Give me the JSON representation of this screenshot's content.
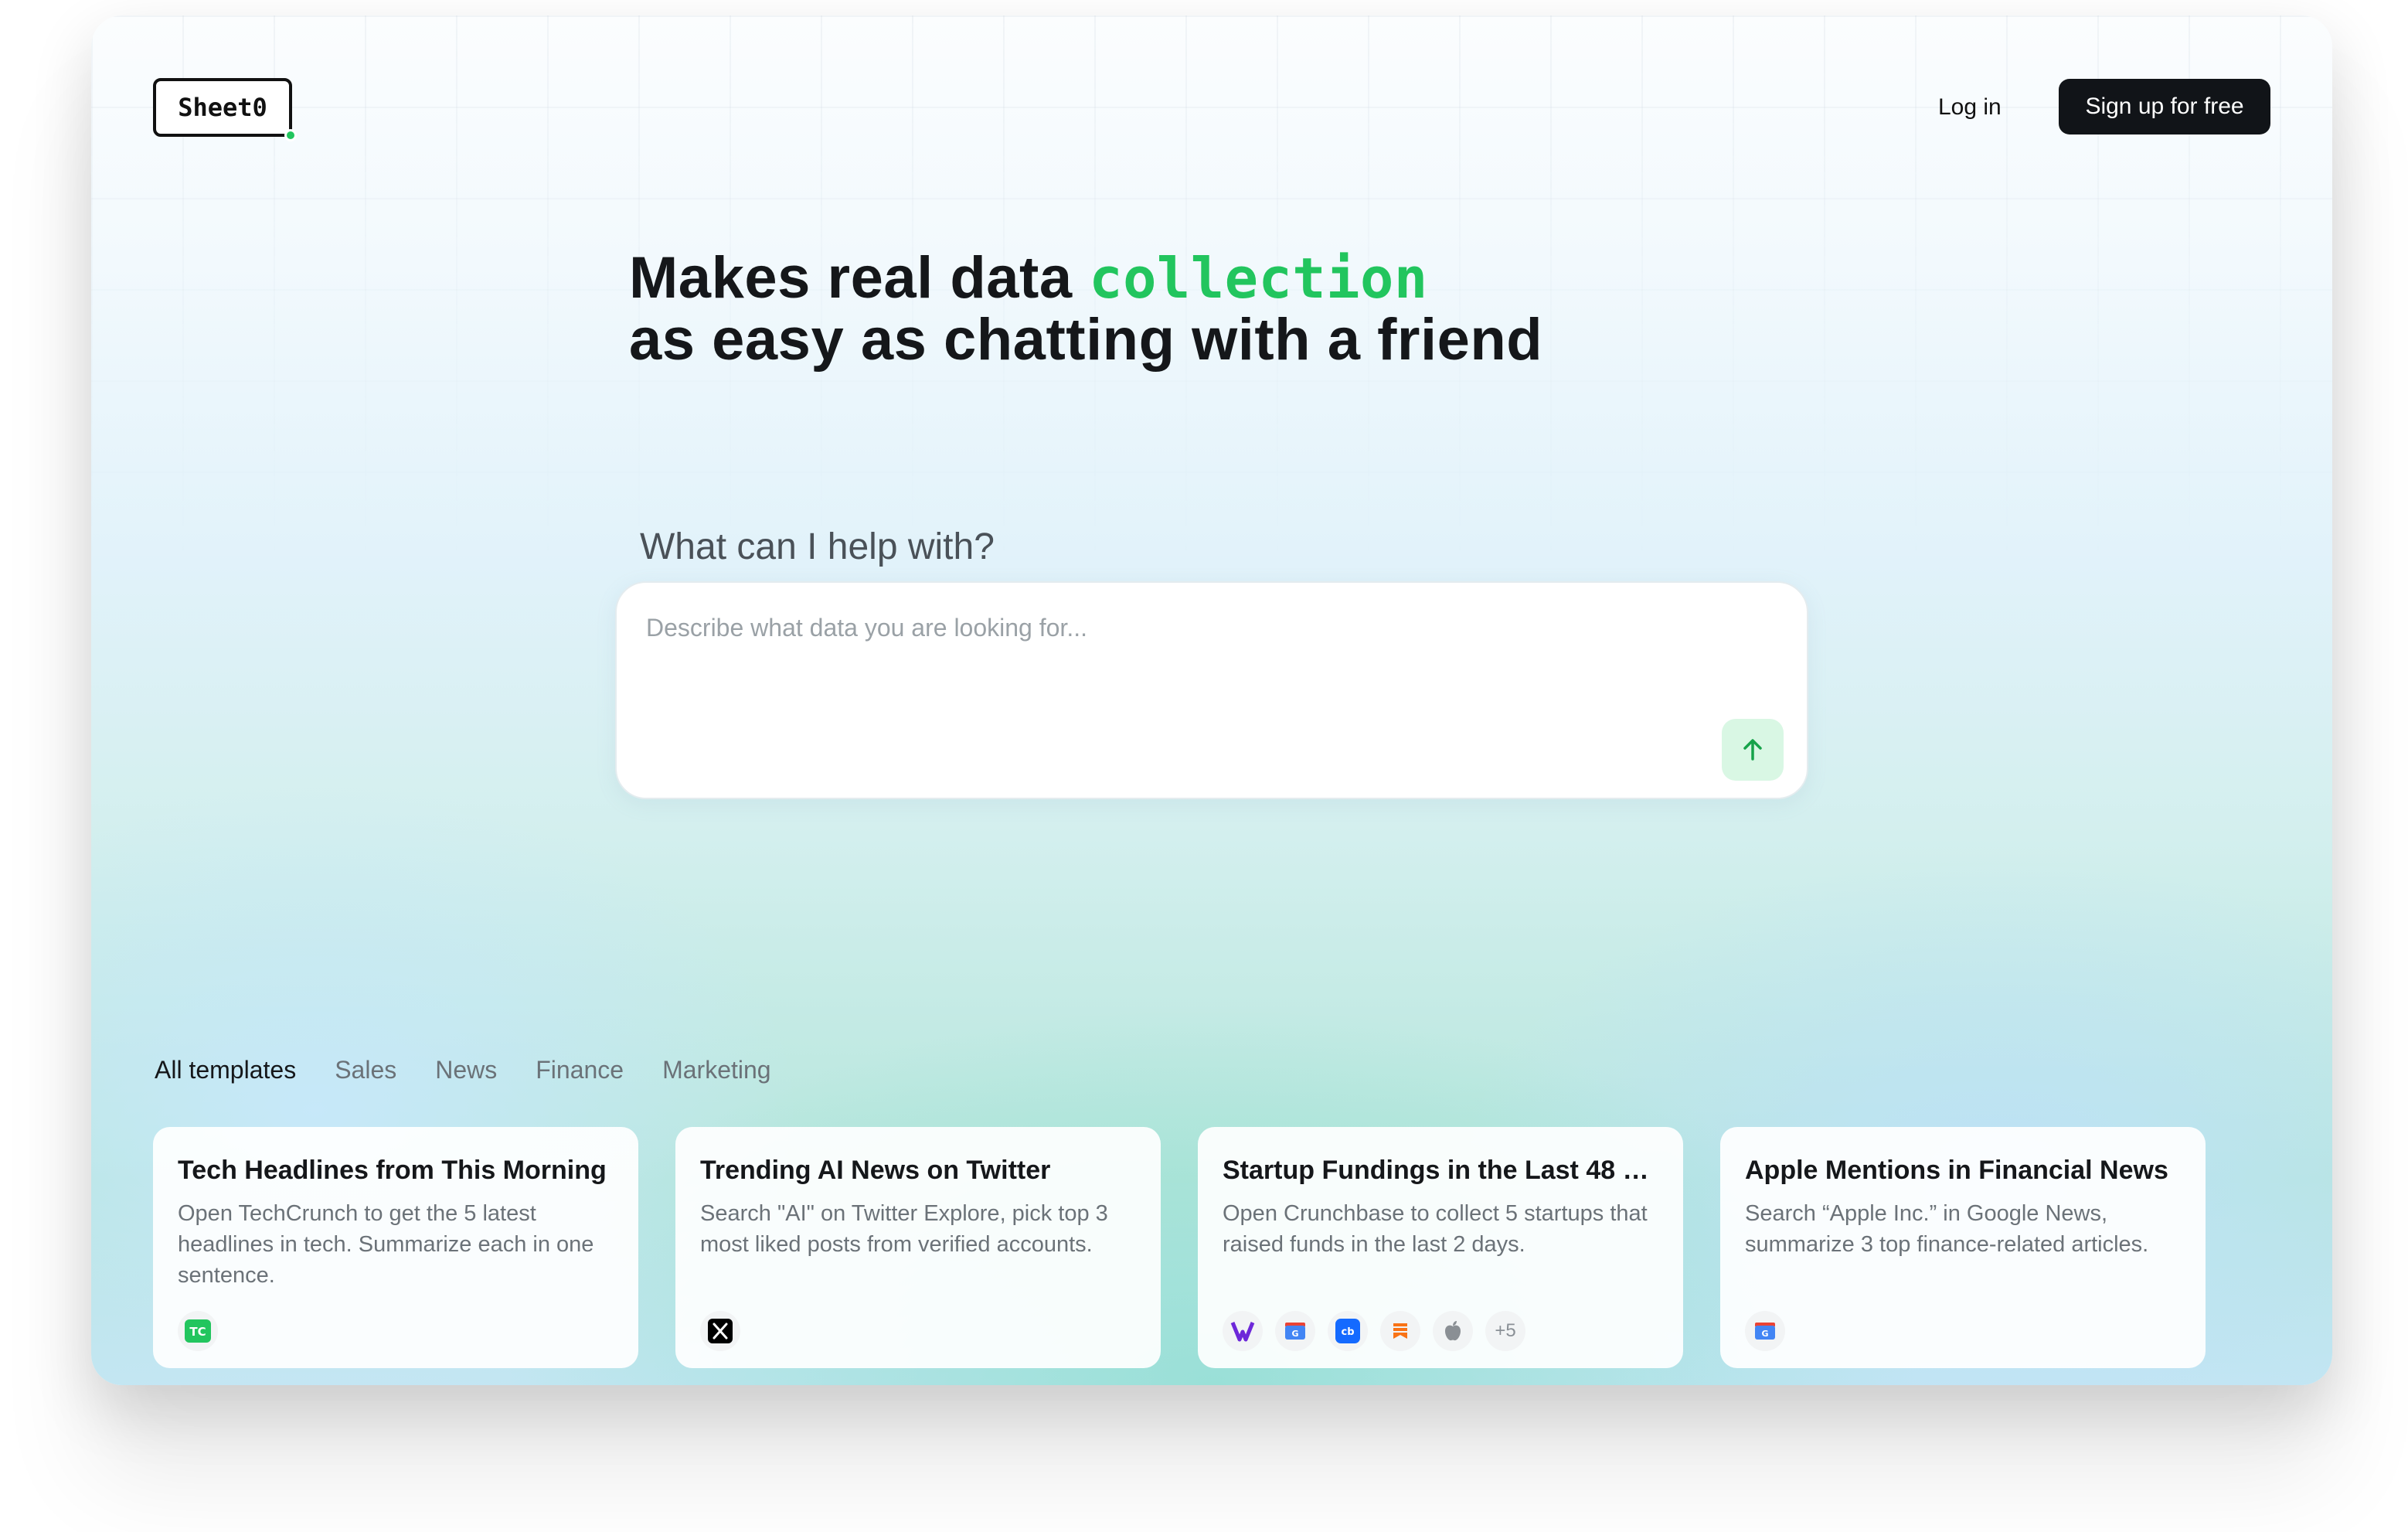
{
  "brand": {
    "logo_text": "Sheet0",
    "accent_color": "#22c55e"
  },
  "nav": {
    "login_label": "Log in",
    "signup_label": "Sign up for free"
  },
  "hero": {
    "line1_prefix": "Makes real data ",
    "line1_accent": "collection",
    "line2": "as easy as chatting with a friend"
  },
  "prompt": {
    "heading": "What can I help with?",
    "placeholder": "Describe what data you are looking for...",
    "value": ""
  },
  "tabs": [
    {
      "label": "All templates",
      "active": true
    },
    {
      "label": "Sales"
    },
    {
      "label": "News"
    },
    {
      "label": "Finance"
    },
    {
      "label": "Marketing"
    }
  ],
  "cards": [
    {
      "title": "Tech Headlines from This Morning",
      "description": "Open TechCrunch to get the 5 latest headlines in tech. Summarize each in one sentence.",
      "icons": [
        "techcrunch-icon"
      ]
    },
    {
      "title": "Trending AI News on Twitter",
      "description": "Search \"AI\" on Twitter Explore, pick top 3 most liked posts from verified accounts.",
      "icons": [
        "x-twitter-icon"
      ]
    },
    {
      "title": "Startup Fundings in the Last 48 H...",
      "description": "Open Crunchbase to collect 5 startups that raised funds in the last 2 days.",
      "icons": [
        "v-icon",
        "google-news-icon",
        "crunchbase-icon",
        "bookmark-icon",
        "apple-icon"
      ],
      "more_label": "+5"
    },
    {
      "title": "Apple Mentions in Financial News",
      "description": "Search “Apple Inc.” in Google News, summarize 3 top finance-related articles.",
      "icons": [
        "google-news-icon"
      ]
    }
  ]
}
